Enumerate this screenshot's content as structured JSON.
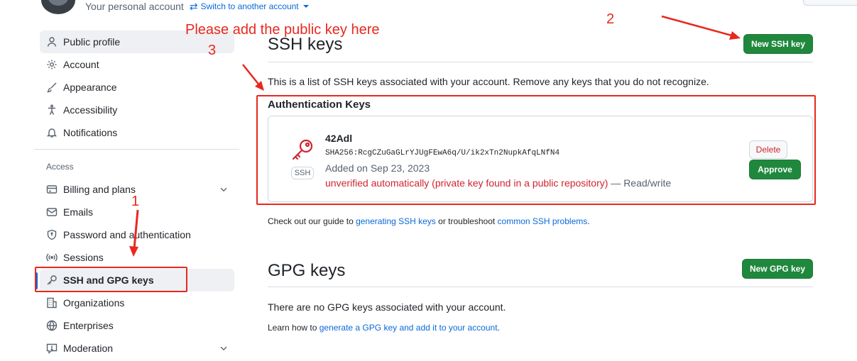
{
  "account": {
    "label": "Your personal account",
    "switch_label": "Switch to another account"
  },
  "sidebar": {
    "items_top": [
      {
        "label": "Public profile",
        "icon": "person-icon",
        "active": true
      },
      {
        "label": "Account",
        "icon": "gear-icon"
      },
      {
        "label": "Appearance",
        "icon": "paintbrush-icon"
      },
      {
        "label": "Accessibility",
        "icon": "accessibility-icon"
      },
      {
        "label": "Notifications",
        "icon": "bell-icon"
      }
    ],
    "section_label": "Access",
    "items_access": [
      {
        "label": "Billing and plans",
        "icon": "credit-card-icon",
        "has_chevron": true
      },
      {
        "label": "Emails",
        "icon": "mail-icon"
      },
      {
        "label": "Password and authentication",
        "icon": "shield-lock-icon"
      },
      {
        "label": "Sessions",
        "icon": "broadcast-icon"
      },
      {
        "label": "SSH and GPG keys",
        "icon": "key-icon",
        "selected": true
      },
      {
        "label": "Organizations",
        "icon": "organization-icon"
      },
      {
        "label": "Enterprises",
        "icon": "globe-icon"
      },
      {
        "label": "Moderation",
        "icon": "report-icon",
        "has_chevron": true
      }
    ]
  },
  "ssh": {
    "title": "SSH keys",
    "new_button": "New SSH key",
    "description": "This is a list of SSH keys associated with your account. Remove any keys that you do not recognize.",
    "auth_title": "Authentication Keys",
    "key": {
      "name": "42Adl",
      "fingerprint": "SHA256:RcgCZuGaGLrYJUgFEwA6q/U/ik2xTn2NupkAfqLNfN4",
      "added": "Added on Sep 23, 2023",
      "status_warning": "unverified automatically (private key found in a public repository)",
      "status_access": " — Read/write",
      "badge": "SSH",
      "delete_label": "Delete",
      "approve_label": "Approve"
    },
    "guide": {
      "prefix": "Check out our guide to ",
      "link1": "generating SSH keys",
      "middle": " or troubleshoot ",
      "link2": "common SSH problems",
      "suffix": "."
    }
  },
  "gpg": {
    "title": "GPG keys",
    "new_button": "New GPG key",
    "empty": "There are no GPG keys associated with your account.",
    "learn_prefix": "Learn how to ",
    "learn_link": "generate a GPG key and add it to your account",
    "learn_suffix": "."
  },
  "annotations": {
    "note": "Please add the public key here",
    "n1": "1",
    "n2": "2",
    "n3": "3",
    "color": "#e8281e"
  },
  "colors": {
    "primary_button": "#1f883d",
    "link": "#0969da",
    "danger": "#d1242f"
  }
}
